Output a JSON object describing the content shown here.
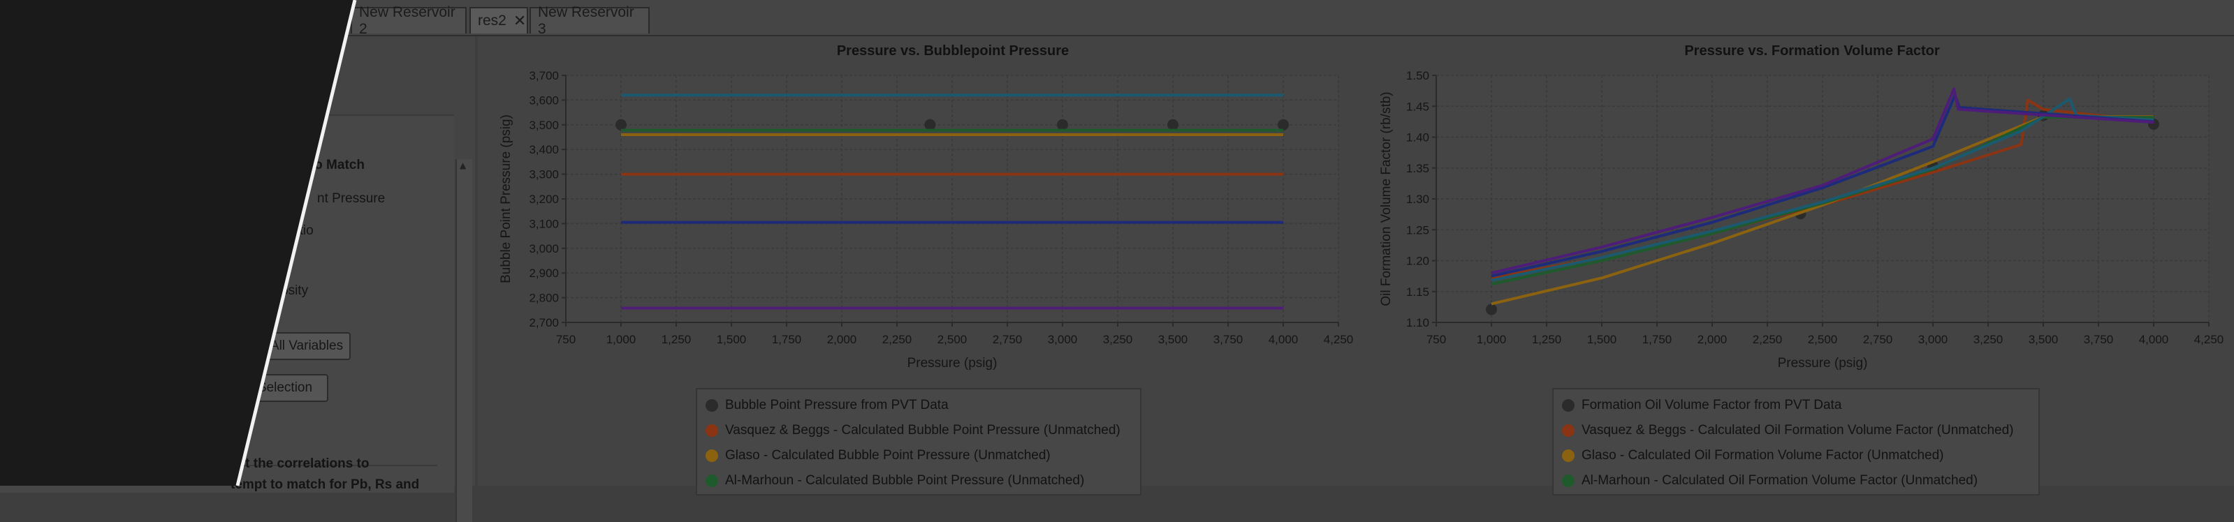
{
  "tabs": [
    {
      "label": "New Reservoir 2",
      "active": false
    },
    {
      "label": "res2",
      "active": true,
      "closable": true
    },
    {
      "label": "New Reservoir 3",
      "active": false
    }
  ],
  "left_panel": {
    "section_title": "s to Match",
    "options": [
      "nt Pressure",
      "atio",
      "osity"
    ],
    "buttons": {
      "all_variables": "All Variables",
      "selection": "Selection"
    },
    "instructions_line1": "ect the correlations to",
    "instructions_line2": "tempt to match for Pb, Rs and"
  },
  "colors": {
    "pvt": "#2b2b2b",
    "vasquez": "#8a3414",
    "glaso": "#8b6310",
    "almarhoun": "#1f5a2c",
    "purple": "#4e1d78",
    "blue": "#1e2a7a",
    "teal": "#1b5a6e"
  },
  "chart_data": [
    {
      "type": "line",
      "title": "Pressure vs. Bubblepoint Pressure",
      "xlabel": "Pressure (psig)",
      "ylabel": "Bubble Point Pressure (psig)",
      "xlim": [
        750,
        4250
      ],
      "ylim": [
        2700,
        3700
      ],
      "xticks": [
        "750",
        "1,000",
        "1,250",
        "1,500",
        "1,750",
        "2,000",
        "2,250",
        "2,500",
        "2,750",
        "3,000",
        "3,250",
        "3,500",
        "3,750",
        "4,000",
        "4,250"
      ],
      "yticks": [
        "2,700",
        "2,800",
        "2,900",
        "3,000",
        "3,100",
        "3,200",
        "3,300",
        "3,400",
        "3,500",
        "3,600",
        "3,700"
      ],
      "grid": true,
      "series": [
        {
          "name": "Bubble Point Pressure from PVT Data",
          "kind": "scatter",
          "color": "#2b2b2b",
          "x": [
            1000,
            2400,
            3000,
            3500,
            4000
          ],
          "y": [
            3500,
            3500,
            3500,
            3500,
            3500
          ]
        },
        {
          "name": "Vasquez & Beggs - Calculated Bubble Point Pressure (Unmatched)",
          "kind": "line",
          "color": "#8a3414",
          "x": [
            1000,
            4000
          ],
          "y": [
            3300,
            3300
          ]
        },
        {
          "name": "Glaso - Calculated Bubble Point Pressure (Unmatched)",
          "kind": "line",
          "color": "#8b6310",
          "x": [
            1000,
            4000
          ],
          "y": [
            3460,
            3460
          ]
        },
        {
          "name": "Al-Marhoun - Calculated Bubble Point Pressure (Unmatched)",
          "kind": "line",
          "color": "#1f5a2c",
          "x": [
            1000,
            4000
          ],
          "y": [
            3478,
            3478
          ]
        },
        {
          "kind": "line",
          "color": "#1b5a6e",
          "x": [
            1000,
            4000
          ],
          "y": [
            3620,
            3620
          ]
        },
        {
          "kind": "line",
          "color": "#1e2a7a",
          "x": [
            1000,
            4000
          ],
          "y": [
            3105,
            3105
          ]
        },
        {
          "kind": "line",
          "color": "#4e1d78",
          "x": [
            1000,
            4000
          ],
          "y": [
            2758,
            2758
          ]
        }
      ]
    },
    {
      "type": "line",
      "title": "Pressure vs. Formation Volume Factor",
      "xlabel": "Pressure (psig)",
      "ylabel": "Oil Formation Volume Factor (rb/stb)",
      "xlim": [
        750,
        4250
      ],
      "ylim": [
        1.1,
        1.5
      ],
      "xticks": [
        "750",
        "1,000",
        "1,250",
        "1,500",
        "1,750",
        "2,000",
        "2,250",
        "2,500",
        "2,750",
        "3,000",
        "3,250",
        "3,500",
        "3,750",
        "4,000",
        "4,250"
      ],
      "yticks": [
        "1.10",
        "1.15",
        "1.20",
        "1.25",
        "1.30",
        "1.35",
        "1.40",
        "1.45",
        "1.50"
      ],
      "grid": true,
      "series": [
        {
          "name": "Formation Oil Volume Factor from PVT Data",
          "kind": "scatter",
          "color": "#2b2b2b",
          "x": [
            1000,
            2400,
            3000,
            3500,
            4000
          ],
          "y": [
            1.121,
            1.276,
            1.353,
            1.435,
            1.421
          ]
        },
        {
          "name": "Vasquez & Beggs - Calculated Oil Formation Volume Factor (Unmatched)",
          "kind": "line",
          "color": "#8a3414",
          "x": [
            1000,
            1500,
            2000,
            2500,
            3000,
            3400,
            3430,
            3500,
            4000
          ],
          "y": [
            1.172,
            1.205,
            1.245,
            1.29,
            1.343,
            1.388,
            1.46,
            1.445,
            1.425
          ]
        },
        {
          "name": "Glaso - Calculated Oil Formation Volume Factor (Unmatched)",
          "kind": "line",
          "color": "#8b6310",
          "x": [
            1000,
            1500,
            2000,
            2500,
            3000,
            3500,
            4000
          ],
          "y": [
            1.13,
            1.172,
            1.228,
            1.29,
            1.36,
            1.433,
            1.433
          ]
        },
        {
          "name": "Al-Marhoun - Calculated Oil Formation Volume Factor (Unmatched)",
          "kind": "line",
          "color": "#1f5a2c",
          "x": [
            1000,
            1500,
            2000,
            2500,
            3000,
            3500,
            4000
          ],
          "y": [
            1.162,
            1.2,
            1.244,
            1.293,
            1.348,
            1.432,
            1.432
          ]
        },
        {
          "kind": "line",
          "color": "#1b5a6e",
          "x": [
            1000,
            1500,
            2000,
            2500,
            3000,
            3400,
            3620,
            3650,
            4000
          ],
          "y": [
            1.168,
            1.205,
            1.248,
            1.295,
            1.35,
            1.41,
            1.462,
            1.435,
            1.428
          ]
        },
        {
          "kind": "line",
          "color": "#1e2a7a",
          "x": [
            1000,
            1500,
            2000,
            2500,
            3000,
            3100,
            3120,
            4000
          ],
          "y": [
            1.175,
            1.215,
            1.262,
            1.318,
            1.385,
            1.468,
            1.448,
            1.425
          ]
        },
        {
          "kind": "line",
          "color": "#4e1d78",
          "x": [
            1000,
            1500,
            2000,
            2500,
            3000,
            3095,
            3115,
            4000
          ],
          "y": [
            1.18,
            1.222,
            1.27,
            1.322,
            1.397,
            1.478,
            1.445,
            1.424
          ]
        }
      ]
    }
  ]
}
